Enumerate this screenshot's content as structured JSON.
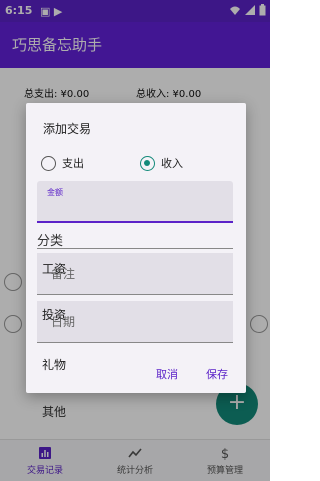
{
  "status_bar": {
    "time": "6:15",
    "notification": "▣ ▶"
  },
  "app_bar": {
    "title": "巧思备忘助手"
  },
  "summary": {
    "expense": "总支出: ¥0.00",
    "income": "总收入: ¥0.00"
  },
  "dialog": {
    "title": "添加交易",
    "radio_expense": "支出",
    "radio_income": "收入",
    "selected": "收入",
    "amount_label": "金额",
    "amount_value": "",
    "category_label": "分类",
    "note_placeholder": "备注",
    "date_placeholder": "日期",
    "options": [
      "工资",
      "投资",
      "礼物",
      "其他"
    ],
    "cancel": "取消",
    "save": "保存"
  },
  "fab": {
    "label": "+"
  },
  "bottom_nav": {
    "items": [
      {
        "label": "交易记录",
        "icon": "bar-chart-icon",
        "active": true
      },
      {
        "label": "统计分析",
        "icon": "trend-icon",
        "active": false
      },
      {
        "label": "预算管理",
        "icon": "dollar-icon",
        "active": false
      }
    ]
  },
  "colors": {
    "primary": "#6221d9",
    "status_bar": "#5b22c8",
    "accent": "#138a7a"
  }
}
